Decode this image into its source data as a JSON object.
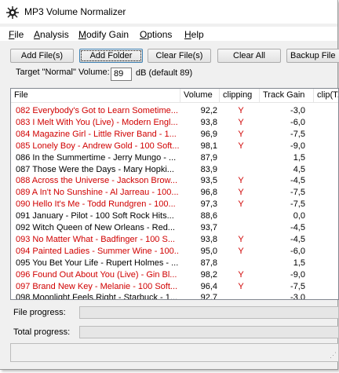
{
  "window": {
    "title": "MP3 Volume Normalizer",
    "icon": "sun-gear-icon"
  },
  "menu": [
    {
      "label_pre": "",
      "label_u": "F",
      "label_post": "ile"
    },
    {
      "label_pre": "",
      "label_u": "A",
      "label_post": "nalysis"
    },
    {
      "label_pre": "",
      "label_u": "M",
      "label_post": "odify Gain"
    },
    {
      "label_pre": "",
      "label_u": "O",
      "label_post": "ptions"
    },
    {
      "label_pre": "",
      "label_u": "H",
      "label_post": "elp"
    }
  ],
  "toolbar": {
    "add_files": "Add File(s)",
    "add_folder": "Add Folder",
    "clear_files": "Clear File(s)",
    "clear_all": "Clear All",
    "backup": "Backup File"
  },
  "target": {
    "label": "Target \"Normal\" Volume:",
    "value": "89",
    "unit": "dB  (default 89)"
  },
  "columns": {
    "file": "File",
    "volume": "Volume",
    "clipping": "clipping",
    "track_gain": "Track Gain",
    "clip_t": "clip(T..."
  },
  "rows": [
    {
      "file": "082 Everybody's Got to Learn Sometime...",
      "volume": "92,2",
      "clipping": "Y",
      "gain": "-3,0",
      "red": true
    },
    {
      "file": "083 I Melt With You (Live) - Modern Engl...",
      "volume": "93,8",
      "clipping": "Y",
      "gain": "-6,0",
      "red": true
    },
    {
      "file": "084 Magazine Girl - Little River Band - 1...",
      "volume": "96,9",
      "clipping": "Y",
      "gain": "-7,5",
      "red": true
    },
    {
      "file": "085 Lonely Boy - Andrew Gold - 100 Soft...",
      "volume": "98,1",
      "clipping": "Y",
      "gain": "-9,0",
      "red": true
    },
    {
      "file": "086 In the Summertime - Jerry Mungo - ...",
      "volume": "87,9",
      "clipping": "",
      "gain": "1,5",
      "red": false
    },
    {
      "file": "087 Those Were the Days - Mary Hopki...",
      "volume": "83,9",
      "clipping": "",
      "gain": "4,5",
      "red": false
    },
    {
      "file": "088 Across the Universe - Jackson Brow...",
      "volume": "93,5",
      "clipping": "Y",
      "gain": "-4,5",
      "red": true
    },
    {
      "file": "089 A In't No Sunshine - Al Jarreau - 100...",
      "volume": "96,8",
      "clipping": "Y",
      "gain": "-7,5",
      "red": true
    },
    {
      "file": "090 Hello It's Me - Todd Rundgren - 100...",
      "volume": "97,3",
      "clipping": "Y",
      "gain": "-7,5",
      "red": true
    },
    {
      "file": "091 January - Pilot - 100 Soft Rock Hits...",
      "volume": "88,6",
      "clipping": "",
      "gain": "0,0",
      "red": false
    },
    {
      "file": "092 Witch Queen of New Orleans - Red...",
      "volume": "93,7",
      "clipping": "",
      "gain": "-4,5",
      "red": false
    },
    {
      "file": "093 No Matter What - Badfinger - 100 S...",
      "volume": "93,8",
      "clipping": "Y",
      "gain": "-4,5",
      "red": true
    },
    {
      "file": "094 Painted Ladies - Summer Wine - 100...",
      "volume": "95,0",
      "clipping": "Y",
      "gain": "-6,0",
      "red": true
    },
    {
      "file": "095 You Bet Your Life - Rupert Holmes - ...",
      "volume": "87,8",
      "clipping": "",
      "gain": "1,5",
      "red": false
    },
    {
      "file": "096 Found Out About You (Live) - Gin Bl...",
      "volume": "98,2",
      "clipping": "Y",
      "gain": "-9,0",
      "red": true
    },
    {
      "file": "097 Brand New Key - Melanie - 100 Soft...",
      "volume": "96,4",
      "clipping": "Y",
      "gain": "-7,5",
      "red": true
    },
    {
      "file": "098 Moonlight Feels Right - Starbuck - 1...",
      "volume": "92,7",
      "clipping": "",
      "gain": "-3,0",
      "red": false
    }
  ],
  "progress": {
    "file_label": "File progress:",
    "total_label": "Total progress:"
  },
  "colors": {
    "clipping_red": "#d00000"
  }
}
